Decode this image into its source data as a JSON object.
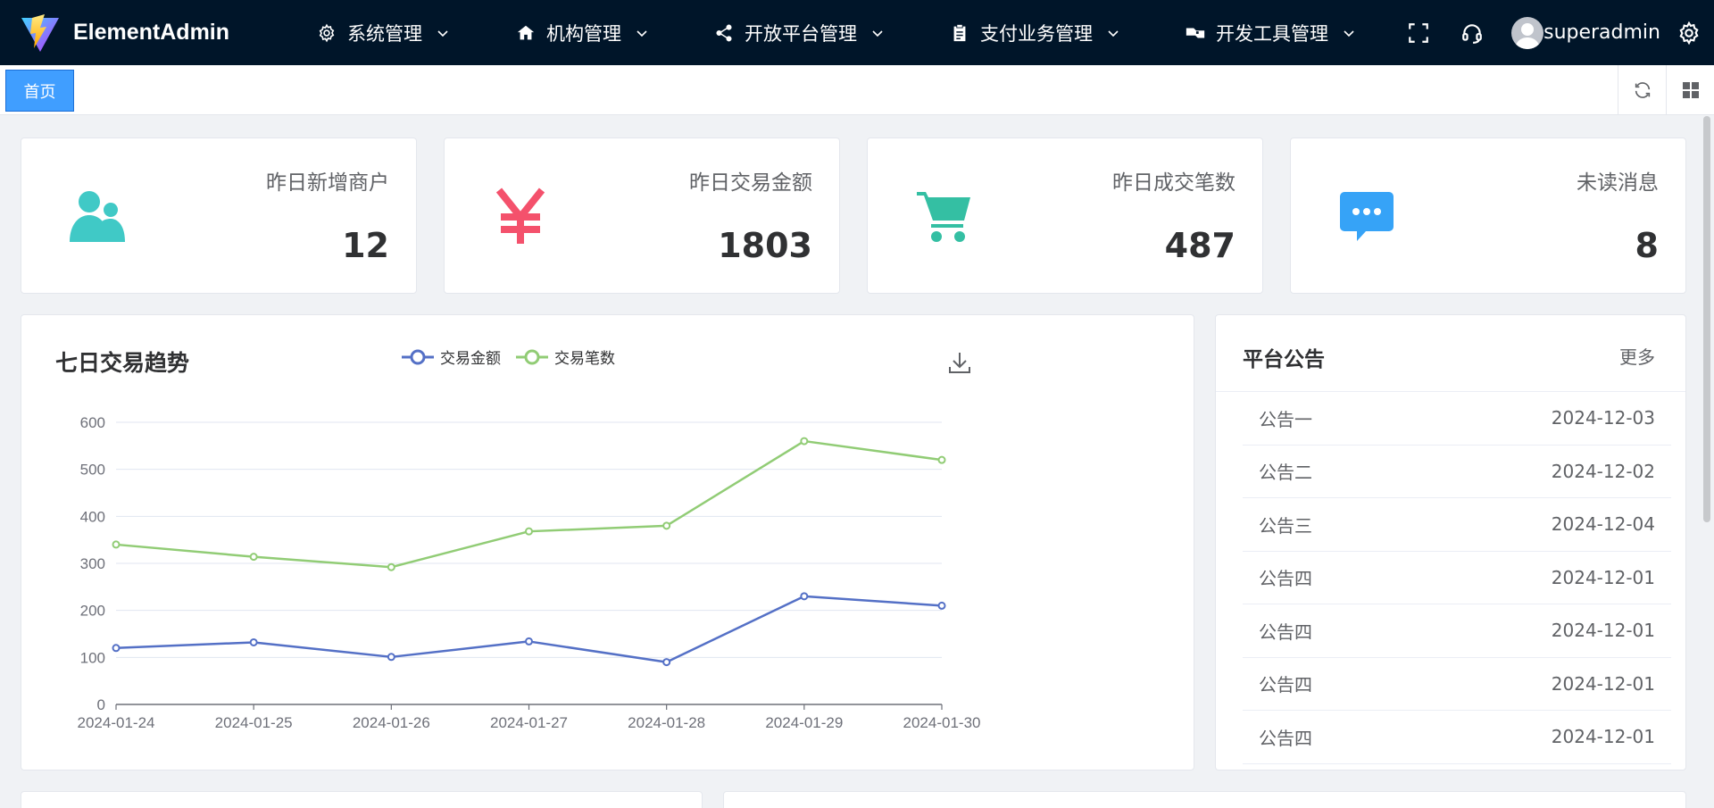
{
  "app": {
    "name": "ElementAdmin"
  },
  "nav": [
    {
      "label": "系统管理",
      "icon": "gear-icon"
    },
    {
      "label": "机构管理",
      "icon": "home-icon"
    },
    {
      "label": "开放平台管理",
      "icon": "share-icon"
    },
    {
      "label": "支付业务管理",
      "icon": "clipboard-icon"
    },
    {
      "label": "开发工具管理",
      "icon": "toolkit-icon"
    }
  ],
  "user": {
    "name": "superadmin"
  },
  "tabs": {
    "home": "首页"
  },
  "stats": [
    {
      "label": "昨日新增商户",
      "value": "12",
      "icon": "users-icon",
      "color": "#40c9c6"
    },
    {
      "label": "昨日交易金额",
      "value": "1803",
      "icon": "yen-icon",
      "color": "#f4516c"
    },
    {
      "label": "昨日成交笔数",
      "value": "487",
      "icon": "cart-icon",
      "color": "#34bfa3"
    },
    {
      "label": "未读消息",
      "value": "8",
      "icon": "message-icon",
      "color": "#36a3f7"
    }
  ],
  "chart": {
    "title": "七日交易趋势"
  },
  "chart_data": {
    "type": "line",
    "x": [
      "2024-01-24",
      "2024-01-25",
      "2024-01-26",
      "2024-01-27",
      "2024-01-28",
      "2024-01-29",
      "2024-01-30"
    ],
    "ylim": [
      0,
      600
    ],
    "yticks": [
      0,
      100,
      200,
      300,
      400,
      500,
      600
    ],
    "grid": true,
    "legend": "top",
    "series": [
      {
        "name": "交易金额",
        "color": "#5470c6",
        "values": [
          120,
          132,
          101,
          134,
          90,
          230,
          210
        ]
      },
      {
        "name": "交易笔数",
        "color": "#91cc75",
        "values": [
          340,
          314,
          292,
          368,
          380,
          560,
          520
        ]
      }
    ]
  },
  "announcements": {
    "title": "平台公告",
    "more": "更多",
    "items": [
      {
        "title": "公告一",
        "date": "2024-12-03"
      },
      {
        "title": "公告二",
        "date": "2024-12-02"
      },
      {
        "title": "公告三",
        "date": "2024-12-04"
      },
      {
        "title": "公告四",
        "date": "2024-12-01"
      },
      {
        "title": "公告四",
        "date": "2024-12-01"
      },
      {
        "title": "公告四",
        "date": "2024-12-01"
      },
      {
        "title": "公告四",
        "date": "2024-12-01"
      }
    ]
  }
}
